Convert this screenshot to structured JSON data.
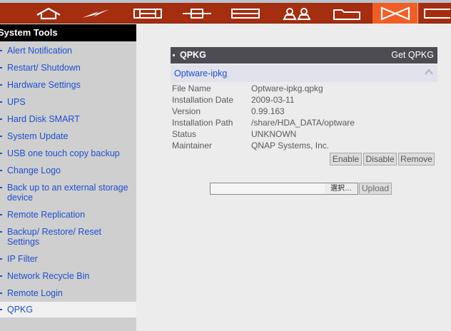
{
  "nav": {
    "icons": [
      "home-icon",
      "lightning-icon",
      "connector-icon",
      "network-plug-icon",
      "drive-icon",
      "users-icon",
      "folder-icon",
      "system-tools-icon",
      "extra-icon"
    ],
    "active_color": "#f15e25",
    "bar_color": "#a52d10"
  },
  "sidebar": {
    "title": "System Tools",
    "items": [
      {
        "label": "Alert Notification"
      },
      {
        "label": "Restart/ Shutdown"
      },
      {
        "label": "Hardware Settings"
      },
      {
        "label": "UPS"
      },
      {
        "label": "Hard Disk SMART"
      },
      {
        "label": "System Update"
      },
      {
        "label": "USB one touch copy backup"
      },
      {
        "label": "Change Logo"
      },
      {
        "label": "Back up to an external storage device"
      },
      {
        "label": "Remote Replication"
      },
      {
        "label": "Backup/ Restore/ Reset Settings"
      },
      {
        "label": "IP Filter"
      },
      {
        "label": "Network Recycle Bin"
      },
      {
        "label": "Remote Login"
      },
      {
        "label": "QPKG",
        "selected": true
      }
    ]
  },
  "qpkg": {
    "title": "QPKG",
    "get_link": "Get QPKG",
    "package_name": "Optware-ipkg",
    "fields": [
      {
        "key": "File Name",
        "value": "Optware-ipkg.qpkg"
      },
      {
        "key": "Installation Date",
        "value": "2009-03-11"
      },
      {
        "key": "Version",
        "value": "0.99.163"
      },
      {
        "key": "Installation Path",
        "value": "/share/HDA_DATA/optware"
      },
      {
        "key": "Status",
        "value": "UNKNOWN"
      },
      {
        "key": "Maintainer",
        "value": "QNAP Systems, Inc."
      }
    ],
    "actions": {
      "enable": "Enable",
      "disable": "Disable",
      "remove": "Remove"
    }
  },
  "upload": {
    "file_value": "",
    "choose_label": "選択…",
    "upload_label": "Upload"
  }
}
